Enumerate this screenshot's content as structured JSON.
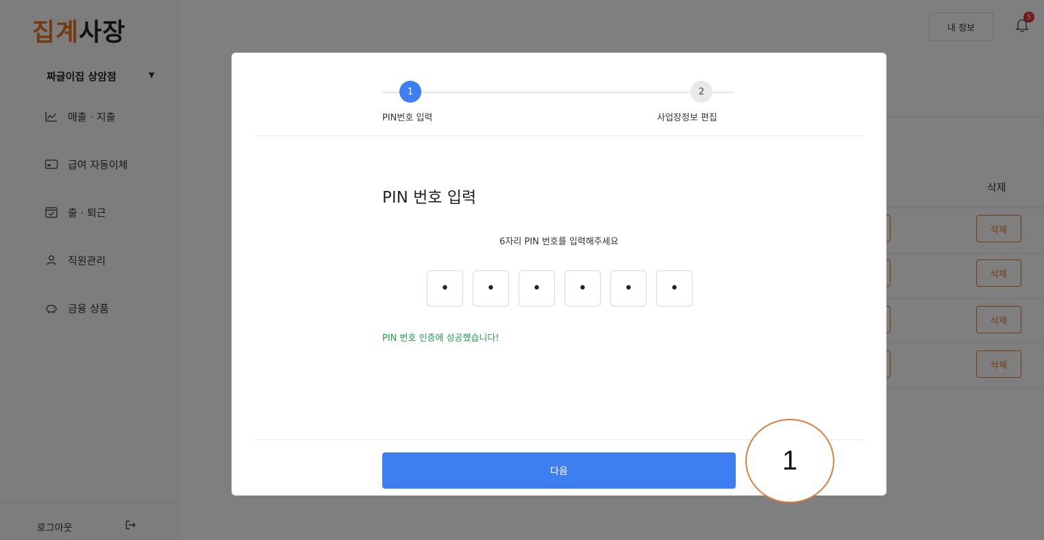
{
  "app": {
    "logo": {
      "part1": "집",
      "part2": "계",
      "part3": "사장"
    },
    "store_name": "짜글이집 상암점",
    "store_caret": "▼",
    "menu": [
      {
        "label": "매출 · 지출",
        "icon": "chart-line-icon"
      },
      {
        "label": "급여 자동이체",
        "icon": "card-icon"
      },
      {
        "label": "출 · 퇴근",
        "icon": "calendar-check-icon"
      },
      {
        "label": "직원관리",
        "icon": "person-icon"
      },
      {
        "label": "금융 상품",
        "icon": "piggy-bank-icon"
      }
    ],
    "logout_label": "로그아웃",
    "my_info_label": "내 정보",
    "notification_count": "5",
    "table": {
      "delete_header": "삭제",
      "delete_label": "삭제"
    }
  },
  "modal": {
    "steps": [
      {
        "number": "1",
        "label": "PIN번호 입력",
        "active": true
      },
      {
        "number": "2",
        "label": "사업장정보 편집",
        "active": false
      }
    ],
    "section_title": "PIN 번호 입력",
    "pin_description": "6자리 PIN 번호를 입력해주세요",
    "pin_digits": [
      "•",
      "•",
      "•",
      "•",
      "•",
      "•"
    ],
    "success_message": "PIN 번호 인증에 성공했습니다!",
    "next_label": "다음"
  },
  "annotation": {
    "label": "1"
  },
  "colors": {
    "accent_orange": "#e8741e",
    "primary_blue": "#3d7ff0",
    "success_green": "#1e9e4a"
  }
}
